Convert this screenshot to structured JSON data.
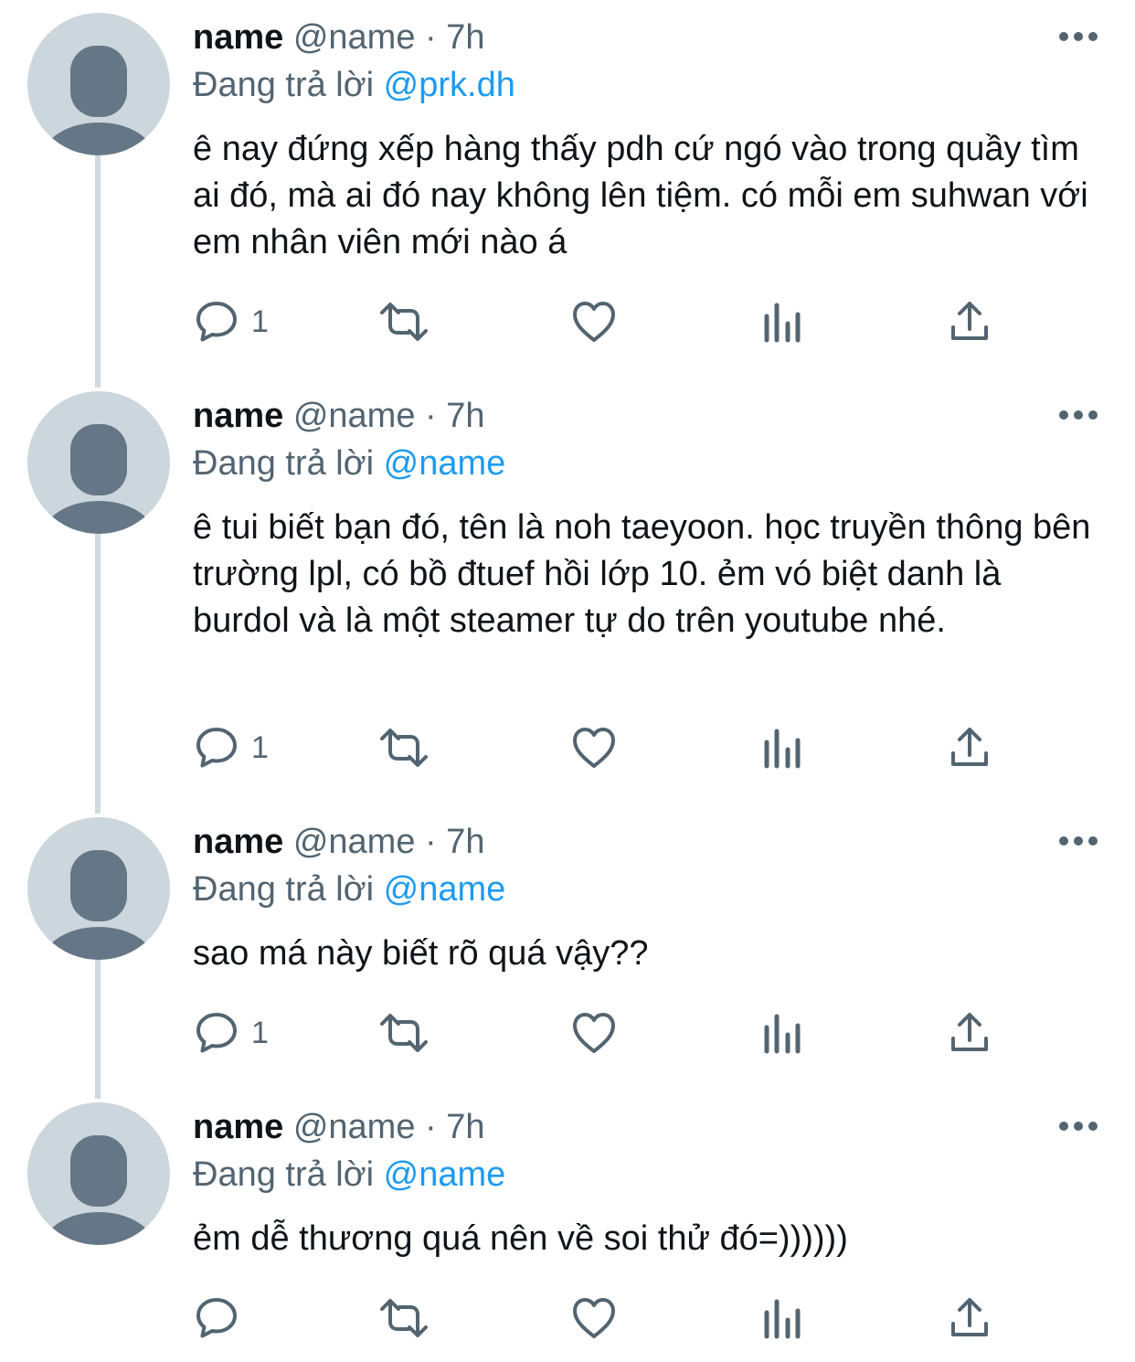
{
  "tweets": [
    {
      "name": "name",
      "handle": "@name",
      "separator": "·",
      "time": "7h",
      "replying_prefix": "Đang trả lời",
      "replying_to": "@prk.dh",
      "text": "ê nay đứng xếp hàng thấy pdh cứ ngó vào trong quầy tìm ai đó, mà ai đó nay không lên tiệm. có mỗi em suhwan với em nhân viên mới nào á",
      "reply_count": "1"
    },
    {
      "name": "name",
      "handle": "@name",
      "separator": "·",
      "time": "7h",
      "replying_prefix": "Đang trả lời",
      "replying_to": "@name",
      "text": "ê tui biết bạn đó, tên là noh taeyoon. học truyền thông bên trường lpl, có bồ đtuef hồi lớp 10. ẻm vó biệt danh là burdol và là một steamer tự do trên youtube nhé.",
      "reply_count": "1"
    },
    {
      "name": "name",
      "handle": "@name",
      "separator": "·",
      "time": "7h",
      "replying_prefix": "Đang trả lời",
      "replying_to": "@name",
      "text": "sao má này biết rõ quá vậy??",
      "reply_count": "1"
    },
    {
      "name": "name",
      "handle": "@name",
      "separator": "·",
      "time": "7h",
      "replying_prefix": "Đang trả lời",
      "replying_to": "@name",
      "text": "ẻm dễ thương quá nên về soi thử đó=))))))",
      "reply_count": ""
    }
  ],
  "icons": {
    "reply": "reply-icon",
    "retweet": "retweet-icon",
    "like": "like-icon",
    "views": "views-icon",
    "share": "share-icon",
    "more": "more-icon",
    "avatar": "default-avatar-icon"
  },
  "colors": {
    "text": "#0f1419",
    "secondary": "#536471",
    "link": "#1d9bf0",
    "thread_line": "#cfd9de",
    "avatar_bg": "#ccd6dd",
    "avatar_figure": "#657786"
  }
}
